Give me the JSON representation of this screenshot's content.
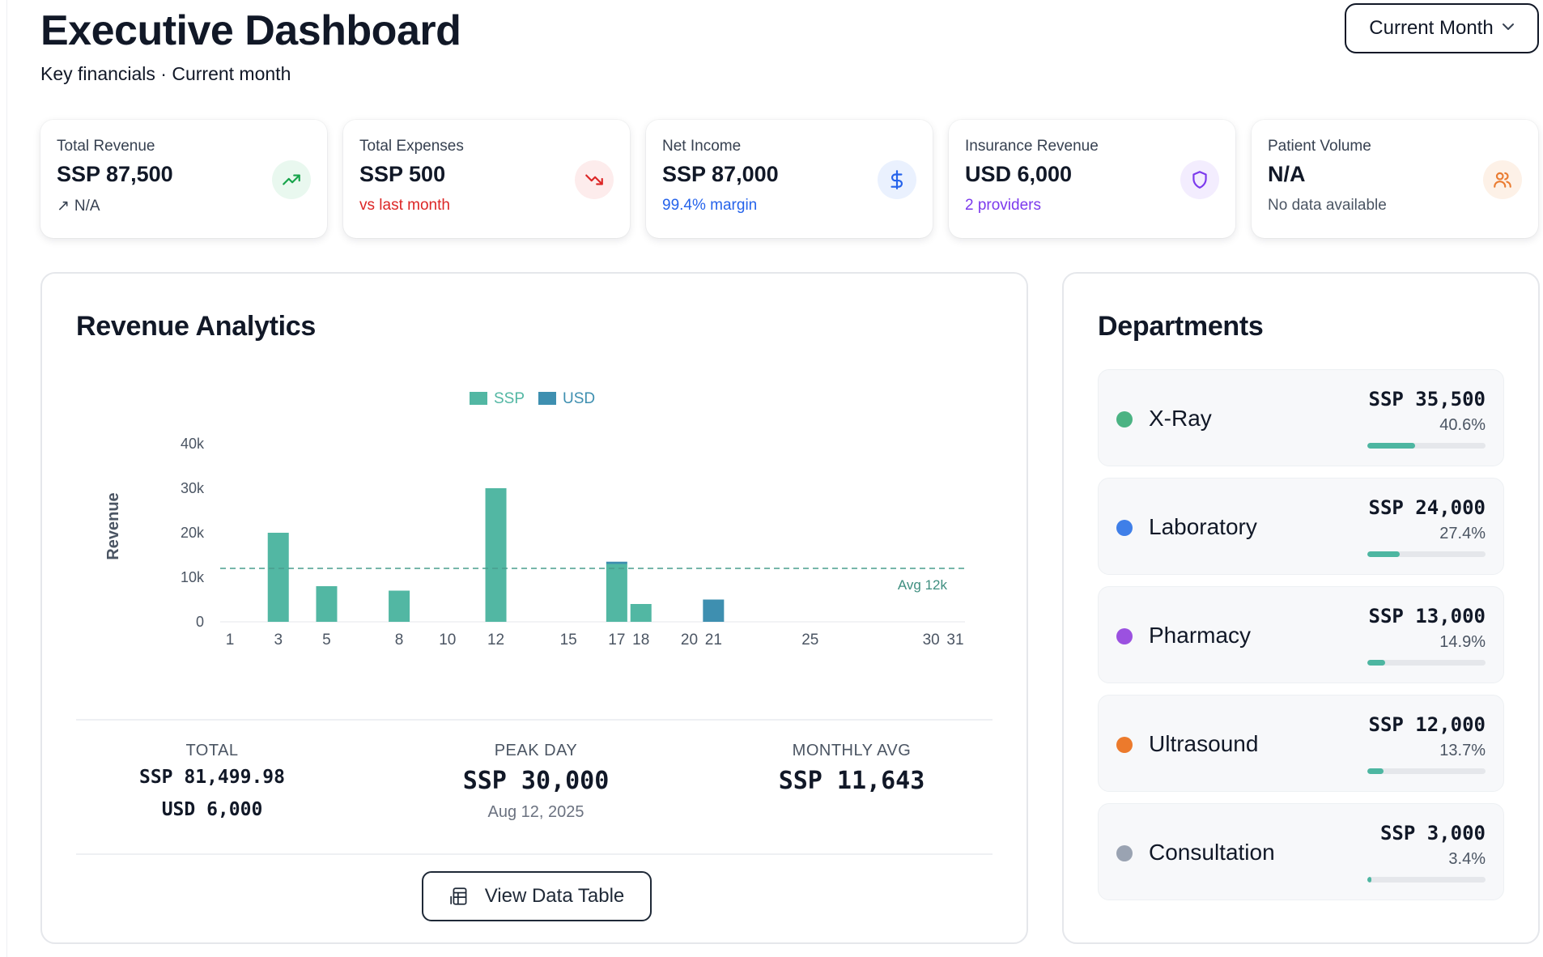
{
  "header": {
    "title": "Executive Dashboard",
    "subtitle": "Key financials · Current month",
    "period_label": "Current Month"
  },
  "kpis": [
    {
      "label": "Total Revenue",
      "value": "SSP 87,500",
      "sub_arrow": "↗",
      "sub": "N/A",
      "sub_color": "#374151",
      "icon": "trending-up-icon",
      "icon_color": "#16a34a",
      "icon_bg": "#e9f8ef"
    },
    {
      "label": "Total Expenses",
      "value": "SSP 500",
      "sub_arrow": "",
      "sub": "vs last month",
      "sub_color": "#dc2626",
      "icon": "trending-down-icon",
      "icon_color": "#dc2626",
      "icon_bg": "#fdecec"
    },
    {
      "label": "Net Income",
      "value": "SSP 87,000",
      "sub_arrow": "",
      "sub": "99.4% margin",
      "sub_color": "#2563eb",
      "icon": "dollar-icon",
      "icon_color": "#2563eb",
      "icon_bg": "#eaf1fe"
    },
    {
      "label": "Insurance Revenue",
      "value": "USD 6,000",
      "sub_arrow": "",
      "sub": "2 providers",
      "sub_color": "#7c3aed",
      "icon": "shield-icon",
      "icon_color": "#7c3aed",
      "icon_bg": "#f3edfe"
    },
    {
      "label": "Patient Volume",
      "value": "N/A",
      "sub_arrow": "",
      "sub": "No data available",
      "sub_color": "#4b5563",
      "icon": "users-icon",
      "icon_color": "#ea7c32",
      "icon_bg": "#fdf1e7"
    }
  ],
  "revenue": {
    "title": "Revenue Analytics",
    "stats": {
      "total_label": "TOTAL",
      "total_ssp": "SSP 81,499.98",
      "total_usd": "USD 6,000",
      "peak_label": "PEAK DAY",
      "peak_value": "SSP 30,000",
      "peak_date": "Aug 12, 2025",
      "avg_label": "MONTHLY AVG",
      "avg_value": "SSP 11,643"
    },
    "view_button": "View Data Table"
  },
  "chart_data": {
    "type": "bar",
    "stacked": true,
    "x": [
      1,
      3,
      5,
      8,
      10,
      12,
      15,
      17,
      18,
      20,
      21,
      25,
      30,
      31
    ],
    "x_ticks": [
      1,
      3,
      5,
      8,
      10,
      12,
      15,
      17,
      18,
      20,
      21,
      25,
      30,
      31
    ],
    "x_range": [
      1,
      31
    ],
    "series": [
      {
        "name": "SSP",
        "color": "#52b7a3",
        "points": [
          [
            3,
            20000
          ],
          [
            5,
            8000
          ],
          [
            8,
            7000
          ],
          [
            12,
            30000
          ],
          [
            17,
            13000
          ],
          [
            18,
            4000
          ]
        ]
      },
      {
        "name": "USD",
        "color": "#3e8fb0",
        "points": [
          [
            17,
            500
          ],
          [
            21,
            5000
          ]
        ]
      }
    ],
    "ylabel": "Revenue",
    "y_ticks": [
      0,
      10000,
      20000,
      30000,
      40000
    ],
    "y_tick_labels": [
      "0",
      "10k",
      "20k",
      "30k",
      "40k"
    ],
    "ylim": [
      0,
      40000
    ],
    "average": 12000,
    "average_label": "Avg 12k",
    "legend": "top-center",
    "grid": false
  },
  "departments": {
    "title": "Departments",
    "items": [
      {
        "name": "X-Ray",
        "amount": "SSP 35,500",
        "pct": "40.6%",
        "share": 0.406,
        "color": "#4bb383"
      },
      {
        "name": "Laboratory",
        "amount": "SSP 24,000",
        "pct": "27.4%",
        "share": 0.274,
        "color": "#3f7fe8"
      },
      {
        "name": "Pharmacy",
        "amount": "SSP 13,000",
        "pct": "14.9%",
        "share": 0.149,
        "color": "#9b51e0"
      },
      {
        "name": "Ultrasound",
        "amount": "SSP 12,000",
        "pct": "13.7%",
        "share": 0.137,
        "color": "#ec7a2c"
      },
      {
        "name": "Consultation",
        "amount": "SSP 3,000",
        "pct": "3.4%",
        "share": 0.034,
        "color": "#9aa3b2"
      }
    ]
  }
}
